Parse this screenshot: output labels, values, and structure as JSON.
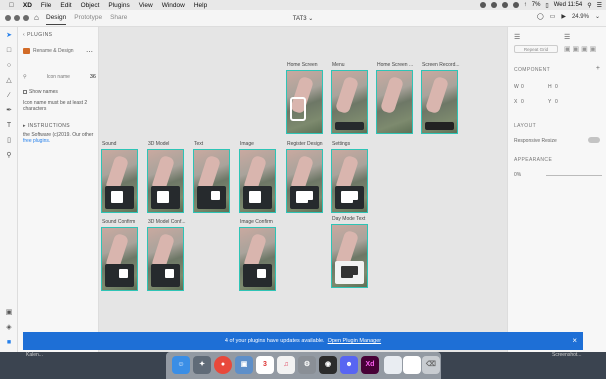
{
  "menubar": {
    "app": "XD",
    "items": [
      "File",
      "Edit",
      "Object",
      "Plugins",
      "View",
      "Window",
      "Help"
    ],
    "battery": "7% ",
    "clock": "Wed 11:54"
  },
  "titlebar": {
    "tabs": [
      "Design",
      "Prototype",
      "Share"
    ],
    "active_tab": "Design",
    "doc_title": "TAT3",
    "zoom": "24.9%"
  },
  "plugins_panel": {
    "header": "PLUGINS",
    "plugin_name": "Rename & Design",
    "search_placeholder": "Icon name",
    "search_value": "36",
    "checkbox_label": "Show names",
    "warning": "Icon name must be at least 2 characters",
    "instructions_header": "INSTRUCTIONS",
    "desc": "the Software (c)2019. Our other",
    "link": "free plugins."
  },
  "canvas": {
    "row1": [
      "Home Screen",
      "Menu",
      "Home Screen ...",
      "Screen Record..."
    ],
    "row2": [
      "Sound",
      "3D Model",
      "Text",
      "Image",
      "Register Design",
      "Settings"
    ],
    "row3": [
      "Sound Confirm",
      "3D Model Conf...",
      "Image Confirm",
      "Day Mode Text"
    ]
  },
  "props": {
    "repeat_grid": "Repeat Grid",
    "component": "COMPONENT",
    "w": "W",
    "h": "H",
    "x": "X",
    "y": "Y",
    "w_val": "0",
    "h_val": "0",
    "x_val": "0",
    "y_val": "0",
    "layout": "LAYOUT",
    "responsive": "Responsive Resize",
    "appearance": "APPEARANCE",
    "opacity": "0%"
  },
  "banner": {
    "text": "4 of your plugins have updates available.",
    "link": "Open Plugin Manager"
  },
  "desktop": {
    "left": "Kalen...",
    "right": "Screenshot..."
  },
  "dock": {
    "xd_label": "Xd",
    "calendar_day": "3"
  }
}
